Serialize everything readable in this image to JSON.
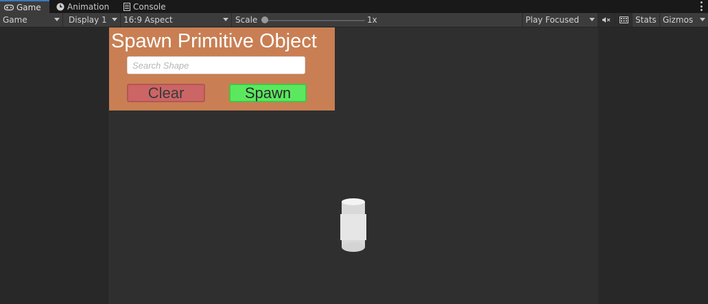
{
  "tabs": [
    {
      "label": "Game",
      "icon": "gamepad-icon",
      "active": true
    },
    {
      "label": "Animation",
      "icon": "clock-icon",
      "active": false
    },
    {
      "label": "Console",
      "icon": "console-icon",
      "active": false
    }
  ],
  "toolbar": {
    "view_mode": "Game",
    "display": "Display 1",
    "aspect": "16:9 Aspect",
    "scale_label": "Scale",
    "scale_value": "1x",
    "play_mode": "Play Focused",
    "stats_label": "Stats",
    "gizmos_label": "Gizmos"
  },
  "game_ui": {
    "title": "Spawn Primitive Object",
    "search_placeholder": "Search Shape",
    "clear_label": "Clear",
    "spawn_label": "Spawn"
  },
  "colors": {
    "panel": "#c97f53",
    "clear_button": "#cc6565",
    "spawn_button": "#5be85f",
    "tab_accent": "#3a79bb"
  }
}
